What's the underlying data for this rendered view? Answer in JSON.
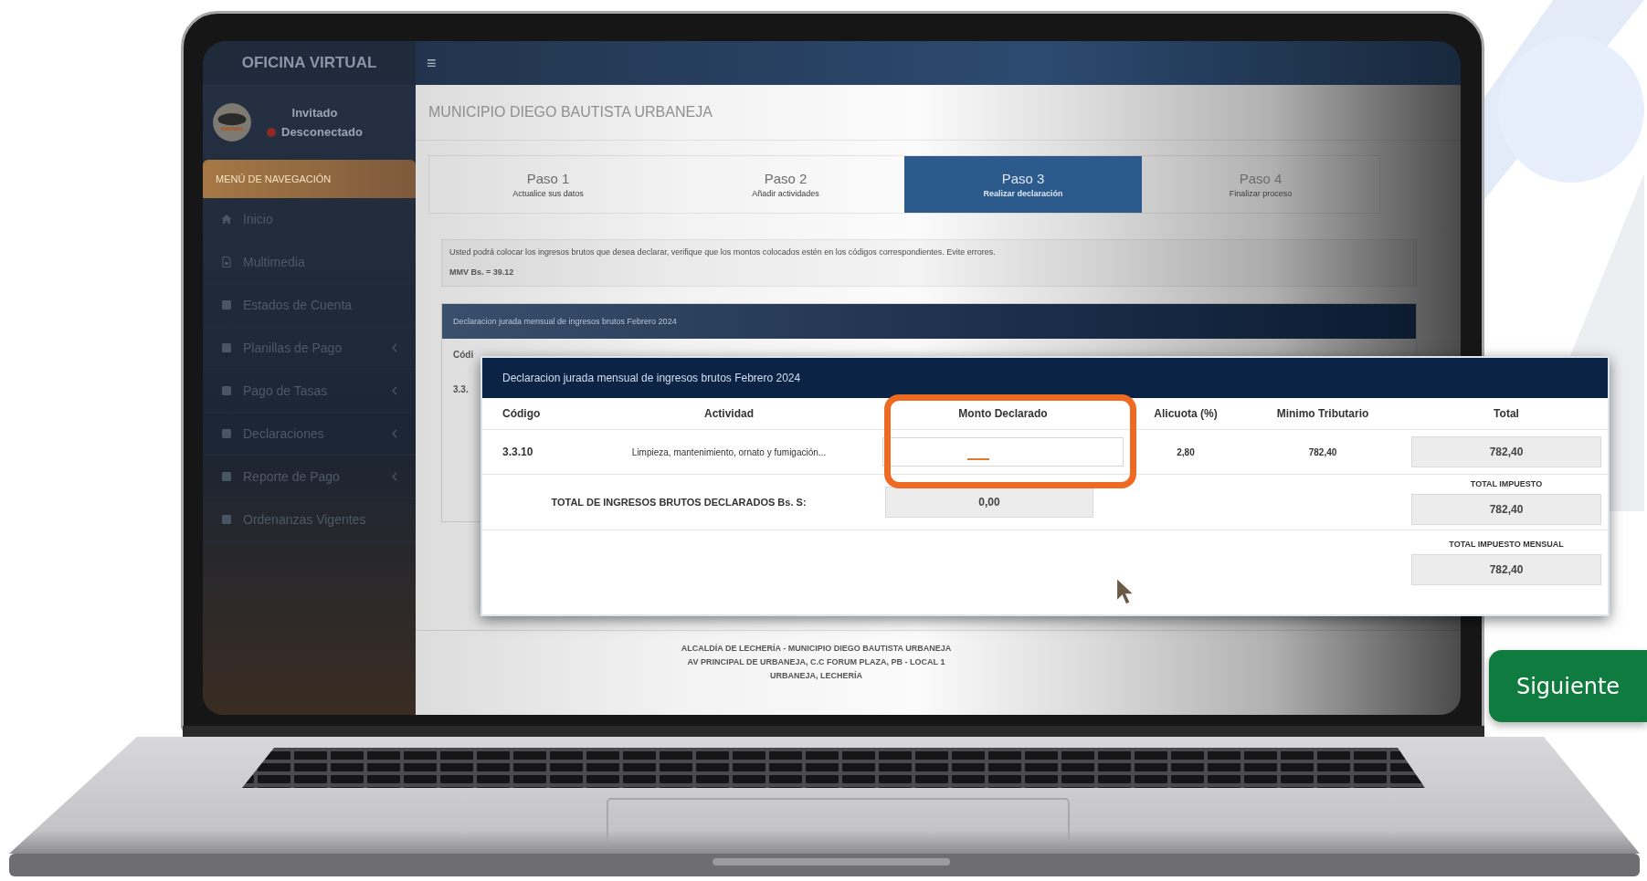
{
  "sidebar": {
    "brand": "OFICINA VIRTUAL",
    "menu_icon": "≡",
    "user": {
      "name": "Invitado",
      "status": "Desconectado",
      "online": false
    },
    "section_title": "MENÚ DE NAVEGACIÓN",
    "items": [
      {
        "label": "Inicio",
        "kind": "home",
        "has_submenu": false
      },
      {
        "label": "Multimedia",
        "kind": "file",
        "has_submenu": false
      },
      {
        "label": "Estados de Cuenta",
        "kind": "square",
        "has_submenu": false
      },
      {
        "label": "Planillas de Pago",
        "kind": "square",
        "has_submenu": true
      },
      {
        "label": "Pago de Tasas",
        "kind": "square",
        "has_submenu": true
      },
      {
        "label": "Declaraciones",
        "kind": "square",
        "has_submenu": true
      },
      {
        "label": "Reporte de Pago",
        "kind": "square",
        "has_submenu": true
      },
      {
        "label": "Ordenanzas Vigentes",
        "kind": "square",
        "has_submenu": false
      }
    ]
  },
  "page_title": "MUNICIPIO DIEGO BAUTISTA URBANEJA",
  "steps": [
    {
      "title": "Paso 1",
      "subtitle": "Actualice sus datos",
      "selected": false
    },
    {
      "title": "Paso 2",
      "subtitle": "Añadir actividades",
      "selected": false
    },
    {
      "title": "Paso 3",
      "subtitle": "Realizar declaración",
      "selected": true
    },
    {
      "title": "Paso 4",
      "subtitle": "Finalizar proceso",
      "selected": false
    }
  ],
  "notice": {
    "text": "Usted podrá colocar los ingresos brutos que desea declarar, verifique que los montos colocados estén en los códigos correspondientes. Evite errores.",
    "mmv": "MMV Bs. = 39.12"
  },
  "background_panel": {
    "title": "Declaracion jurada mensual de ingresos brutos Febrero 2024",
    "column_1": "Códi",
    "row_1": "3.3."
  },
  "popup": {
    "title": "Declaracion jurada mensual de ingresos brutos Febrero 2024",
    "columns": [
      {
        "label": "Código",
        "highlighted": false
      },
      {
        "label": "Actividad",
        "highlighted": false
      },
      {
        "label": "Monto Declarado",
        "highlighted": true
      },
      {
        "label": "Alicuota (%)",
        "highlighted": false
      },
      {
        "label": "Minimo Tributario",
        "highlighted": false
      },
      {
        "label": "Total",
        "highlighted": false
      }
    ],
    "rows": [
      {
        "codigo": "3.3.10",
        "actividad": "Limpieza, mantenimiento, ornato y fumigación...",
        "alicuota": "2,80",
        "minimo": "782,40",
        "total": "782,40"
      }
    ],
    "total_declarado_label": "TOTAL DE INGRESOS BRUTOS DECLARADOS Bs. S:",
    "total_declarado": "0,00",
    "total_impuesto_label": "TOTAL IMPUESTO",
    "total_impuesto": "782,40",
    "total_mensual_label": "TOTAL IMPUESTO MENSUAL",
    "total_mensual": "782,40"
  },
  "footer": [
    "ALCALDÍA DE LECHERÍA - MUNICIPIO DIEGO BAUTISTA URBANEJA",
    "AV PRINCIPAL DE URBANEJA, C.C FORUM PLAZA, PB - LOCAL 1",
    "URBANEJA, LECHERÍA"
  ],
  "next_button": "Siguiente"
}
